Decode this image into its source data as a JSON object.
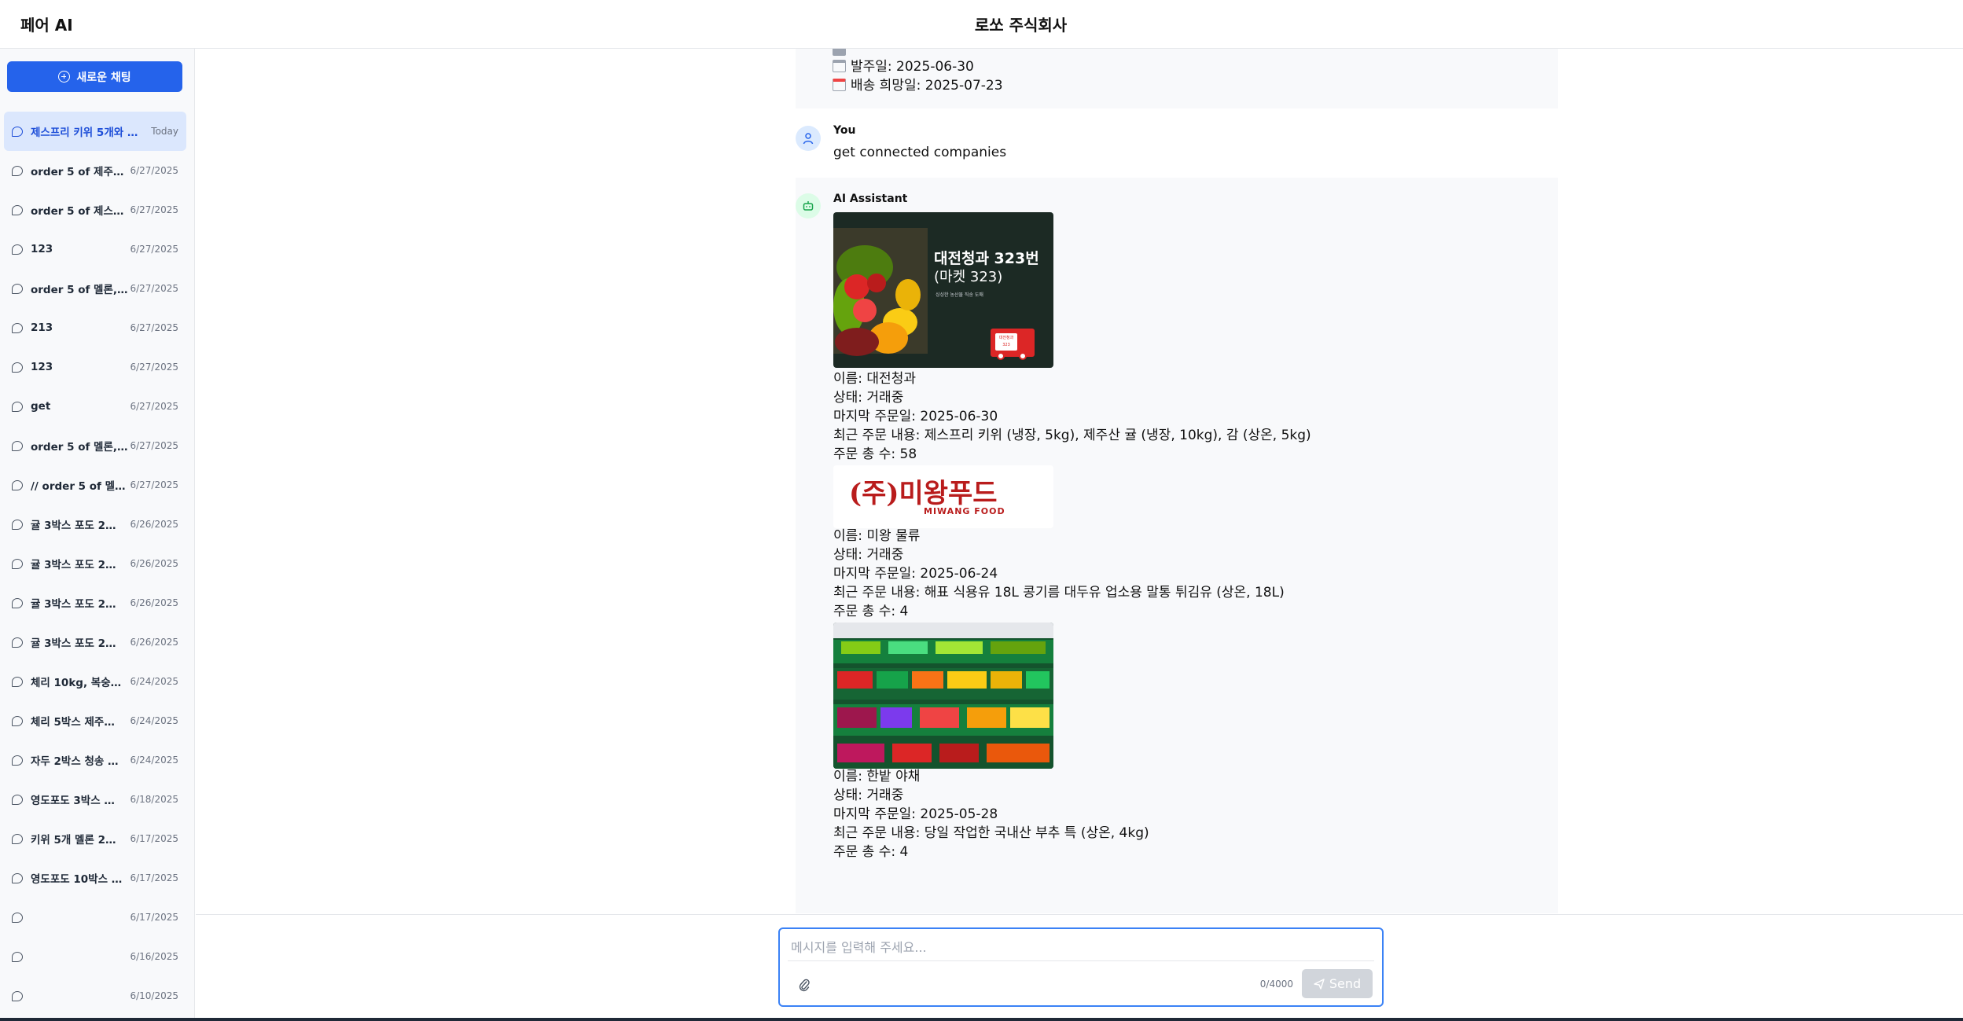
{
  "app": {
    "brand": "페어 AI",
    "company": "로쏘 주식회사"
  },
  "sidebar": {
    "new_chat_label": "새로운 채팅",
    "chats": [
      {
        "title": "제스프리 키위 5개와 …",
        "date": "Today",
        "active": true
      },
      {
        "title": "order 5 of 제주…",
        "date": "6/27/2025"
      },
      {
        "title": "order 5 of 제스…",
        "date": "6/27/2025"
      },
      {
        "title": "123",
        "date": "6/27/2025"
      },
      {
        "title": "order 5 of 멜론, …",
        "date": "6/27/2025"
      },
      {
        "title": "213",
        "date": "6/27/2025"
      },
      {
        "title": "123",
        "date": "6/27/2025"
      },
      {
        "title": "get",
        "date": "6/27/2025"
      },
      {
        "title": "order 5 of 멜론, …",
        "date": "6/27/2025"
      },
      {
        "title": "// order 5 of 멜…",
        "date": "6/27/2025"
      },
      {
        "title": "귤 3박스 포도 2…",
        "date": "6/26/2025"
      },
      {
        "title": "귤 3박스 포도 2…",
        "date": "6/26/2025"
      },
      {
        "title": "귤 3박스 포도 2…",
        "date": "6/26/2025"
      },
      {
        "title": "귤 3박스 포도 2…",
        "date": "6/26/2025"
      },
      {
        "title": "체리 10kg, 복숭…",
        "date": "6/24/2025"
      },
      {
        "title": "체리 5박스 제주…",
        "date": "6/24/2025"
      },
      {
        "title": "자두 2박스 청송 …",
        "date": "6/24/2025"
      },
      {
        "title": "영도포도 3박스 …",
        "date": "6/18/2025"
      },
      {
        "title": "키위 5개 멜론 2…",
        "date": "6/17/2025"
      },
      {
        "title": "영도포도 10박스 …",
        "date": "6/17/2025"
      },
      {
        "title": "",
        "date": "6/17/2025"
      },
      {
        "title": "",
        "date": "6/16/2025"
      },
      {
        "title": "",
        "date": "6/10/2025"
      }
    ]
  },
  "conversation": {
    "prev_tail": {
      "order_date": "발주일: 2025-06-30",
      "delivery_date": "배송 희망일: 2025-07-23"
    },
    "user_message": {
      "role": "You",
      "text": "get connected companies"
    },
    "ai_message": {
      "role": "AI Assistant",
      "companies": [
        {
          "name": "이름: 대전청과",
          "status": "상태: 거래중",
          "last_order": "마지막 주문일: 2025-06-30",
          "recent_items": "최근 주문 내용: 제스프리 키위 (냉장, 5kg), 제주산 귤 (냉장, 10kg), 감 (상온, 5kg)",
          "total_orders": "주문 총 수: 58",
          "image": {
            "title": "대전청과 323번",
            "subtitle": "(마켓 323)",
            "tagline": "싱싱한 농산물 직송 도매",
            "truck_label_1": "대전청과",
            "truck_label_2": "323"
          }
        },
        {
          "name": "이름: 미왕 물류",
          "status": "상태: 거래중",
          "last_order": "마지막 주문일: 2025-06-24",
          "recent_items": "최근 주문 내용: 해표 식용유 18L 콩기름 대두유 업소용 말통 튀김유 (상온, 18L)",
          "total_orders": "주문 총 수: 4",
          "image": {
            "logo_ko": "(주)미왕푸드",
            "logo_en": "MIWANG FOOD"
          }
        },
        {
          "name": "이름: 한밭 야채",
          "status": "상태: 거래중",
          "last_order": "마지막 주문일: 2025-05-28",
          "recent_items": "최근 주문 내용: 당일 작업한 국내산 부추 특 (상온, 4kg)",
          "total_orders": "주문 총 수: 4"
        }
      ]
    }
  },
  "composer": {
    "placeholder": "메시지를 입력해 주세요...",
    "counter": "0/4000",
    "send_label": "Send"
  },
  "colors": {
    "accent": "#2563eb",
    "focus_border": "#3b82f6",
    "sidebar_bg": "#f8f9fb",
    "active_chat_bg": "#dbe7fd"
  }
}
